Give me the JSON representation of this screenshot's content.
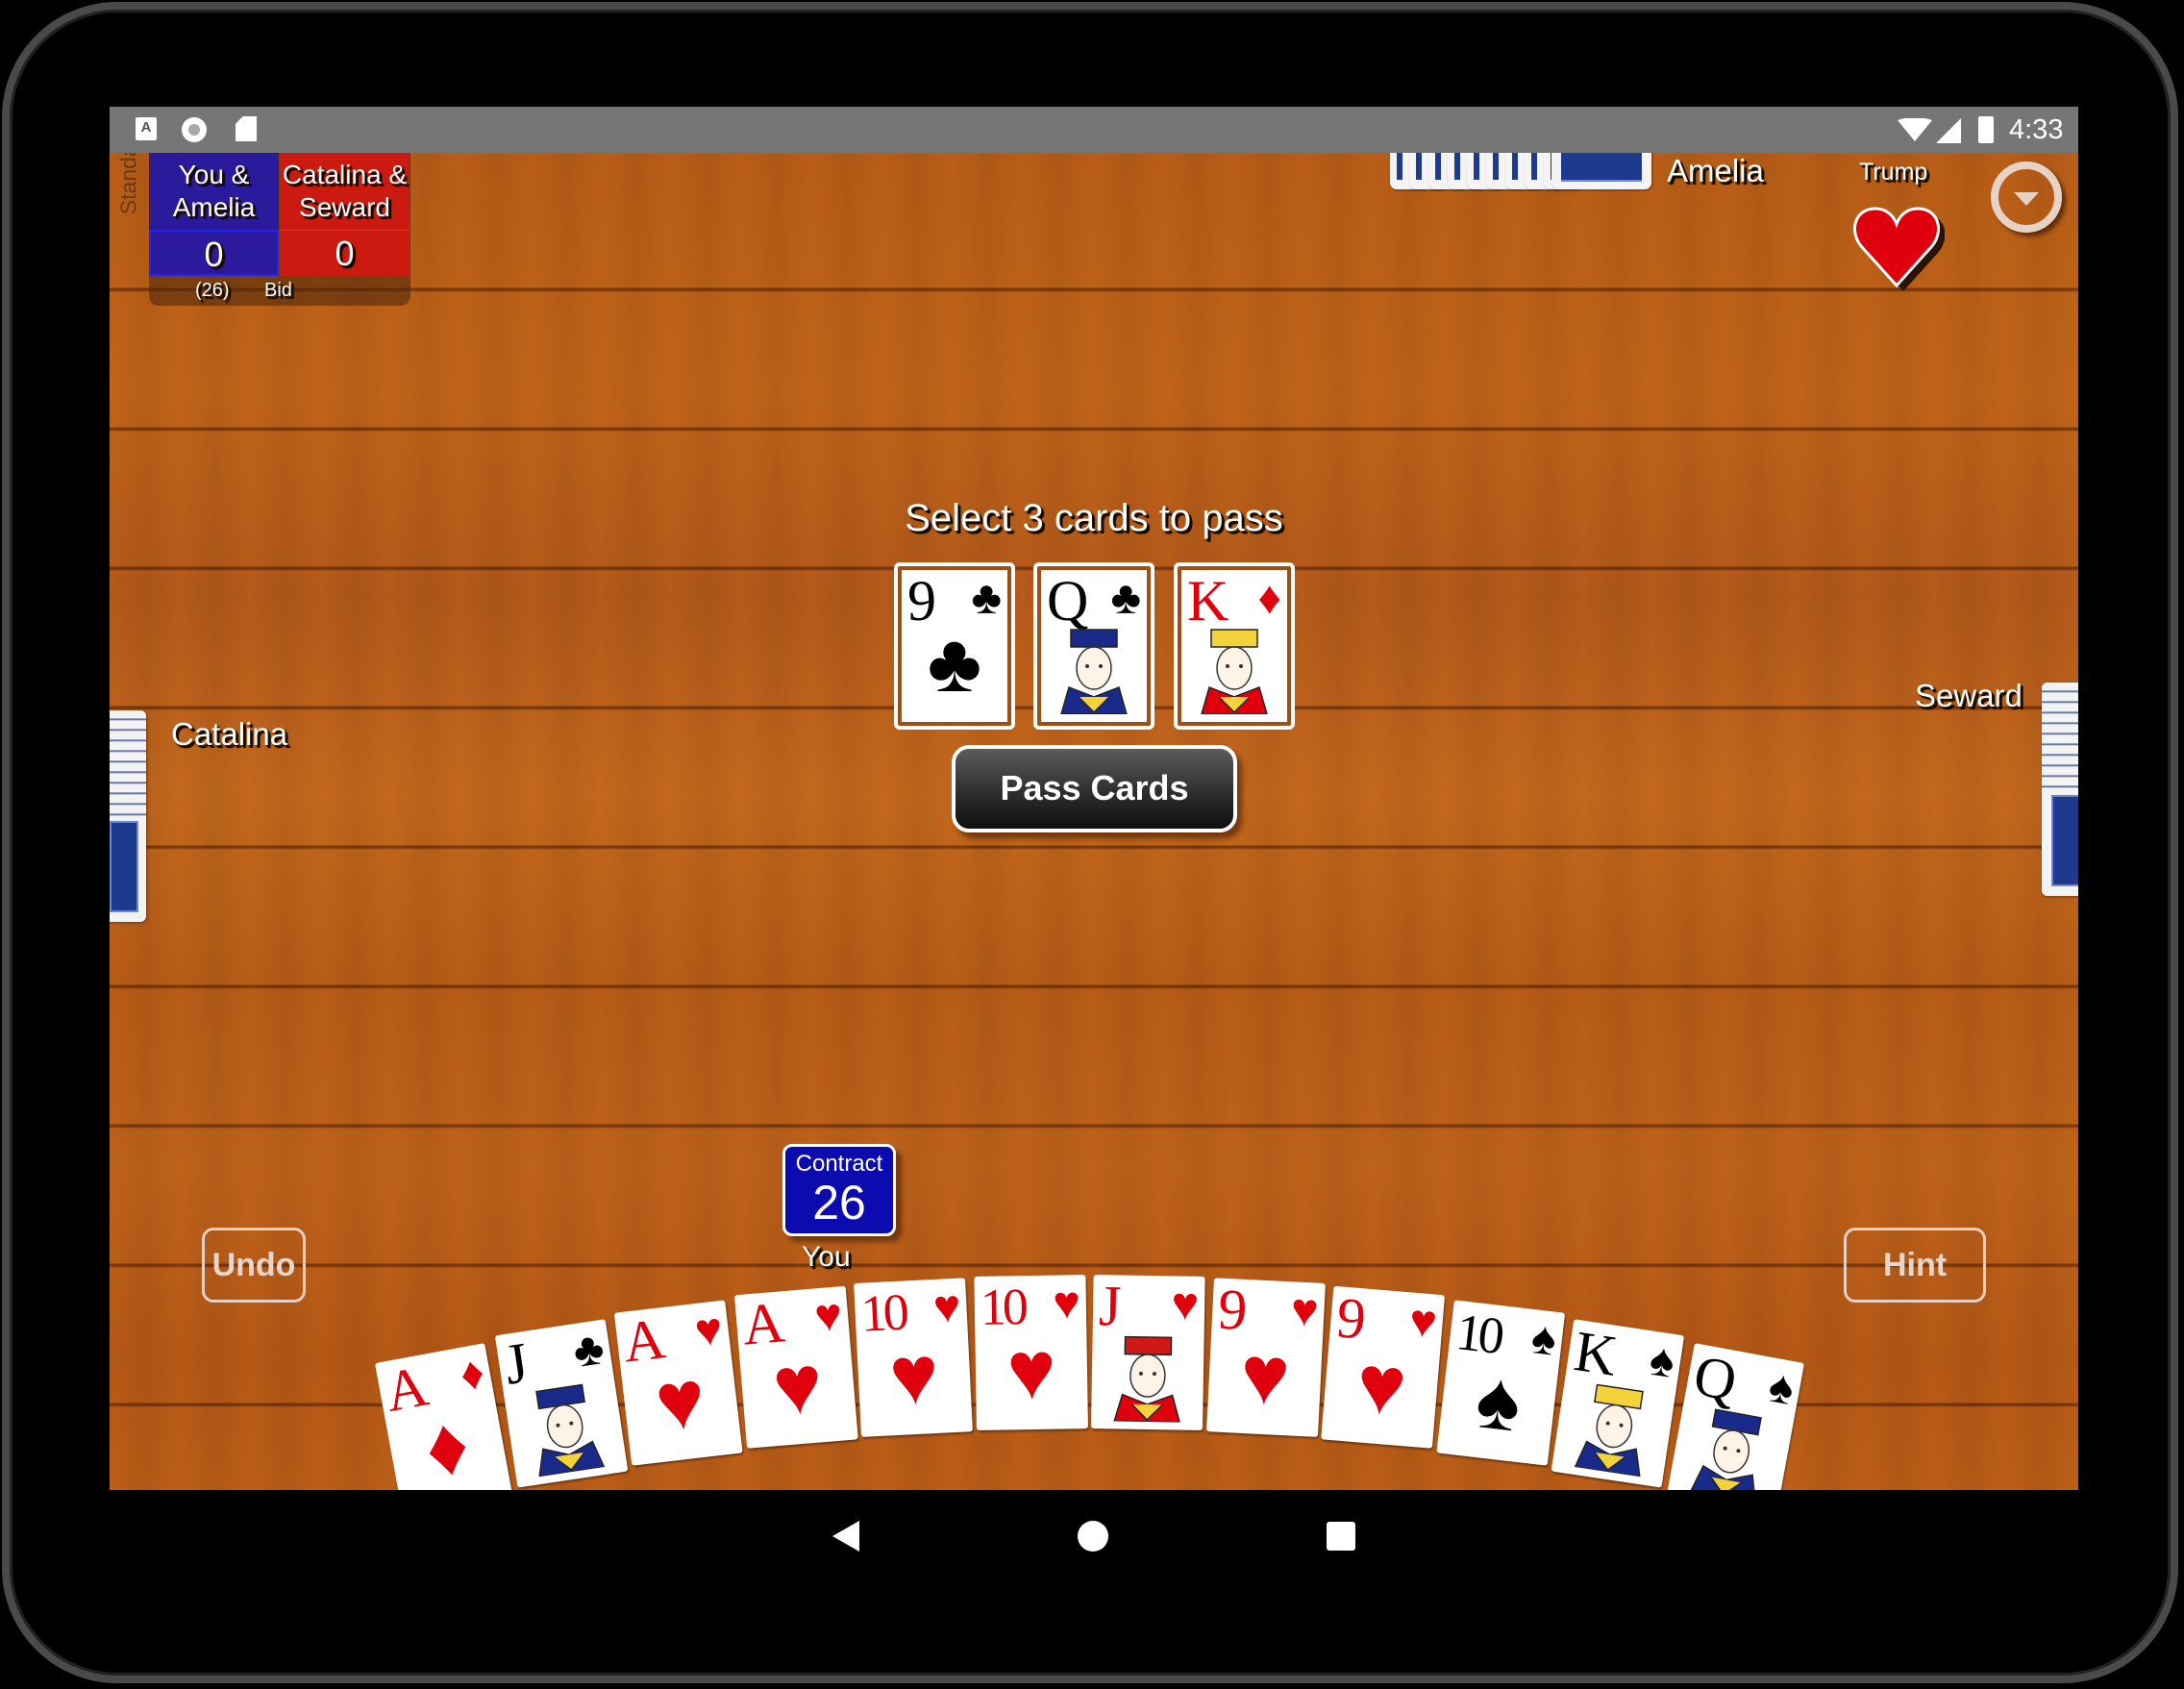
{
  "status_bar": {
    "time": "4:33",
    "left_icons": [
      "keyboard-a-icon",
      "record-circle-icon",
      "sd-card-icon"
    ],
    "right_icons": [
      "wifi-icon",
      "signal-icon",
      "battery-charging-icon"
    ]
  },
  "scoreboard": {
    "mode_label": "Standard",
    "teams": [
      {
        "name_line1": "You &",
        "name_line2": "Amelia",
        "score": "0",
        "color": "#2b1a9c"
      },
      {
        "name_line1": "Catalina &",
        "name_line2": "Seward",
        "score": "0",
        "color": "#cc1a10"
      }
    ],
    "bid_value": "(26)",
    "bid_label": "Bid"
  },
  "players": {
    "top": "Amelia",
    "left": "Catalina",
    "right": "Seward",
    "bottom": "You"
  },
  "trump": {
    "label": "Trump",
    "suit": "hearts",
    "glyph": "♥",
    "color": "#e0000d"
  },
  "prompt": "Select 3 cards to pass",
  "pass_cards": [
    {
      "rank": "9",
      "suit": "♣",
      "color": "black",
      "court": false
    },
    {
      "rank": "Q",
      "suit": "♣",
      "color": "black",
      "court": true
    },
    {
      "rank": "K",
      "suit": "♦",
      "color": "red",
      "court": true
    }
  ],
  "pass_button": "Pass Cards",
  "contract": {
    "label": "Contract",
    "value": "26"
  },
  "buttons": {
    "undo": "Undo",
    "hint": "Hint"
  },
  "hand": [
    {
      "rank": "A",
      "suit": "♦",
      "color": "red",
      "court": false
    },
    {
      "rank": "J",
      "suit": "♣",
      "color": "black",
      "court": true
    },
    {
      "rank": "A",
      "suit": "♥",
      "color": "red",
      "court": false
    },
    {
      "rank": "A",
      "suit": "♥",
      "color": "red",
      "court": false
    },
    {
      "rank": "10",
      "suit": "♥",
      "color": "red",
      "court": false
    },
    {
      "rank": "10",
      "suit": "♥",
      "color": "red",
      "court": false
    },
    {
      "rank": "J",
      "suit": "♥",
      "color": "red",
      "court": true
    },
    {
      "rank": "9",
      "suit": "♥",
      "color": "red",
      "court": false
    },
    {
      "rank": "9",
      "suit": "♥",
      "color": "red",
      "court": false
    },
    {
      "rank": "10",
      "suit": "♠",
      "color": "black",
      "court": false
    },
    {
      "rank": "K",
      "suit": "♠",
      "color": "black",
      "court": true
    },
    {
      "rank": "Q",
      "suit": "♠",
      "color": "black",
      "court": true
    }
  ],
  "nav": [
    "back-icon",
    "home-icon",
    "recents-icon"
  ]
}
